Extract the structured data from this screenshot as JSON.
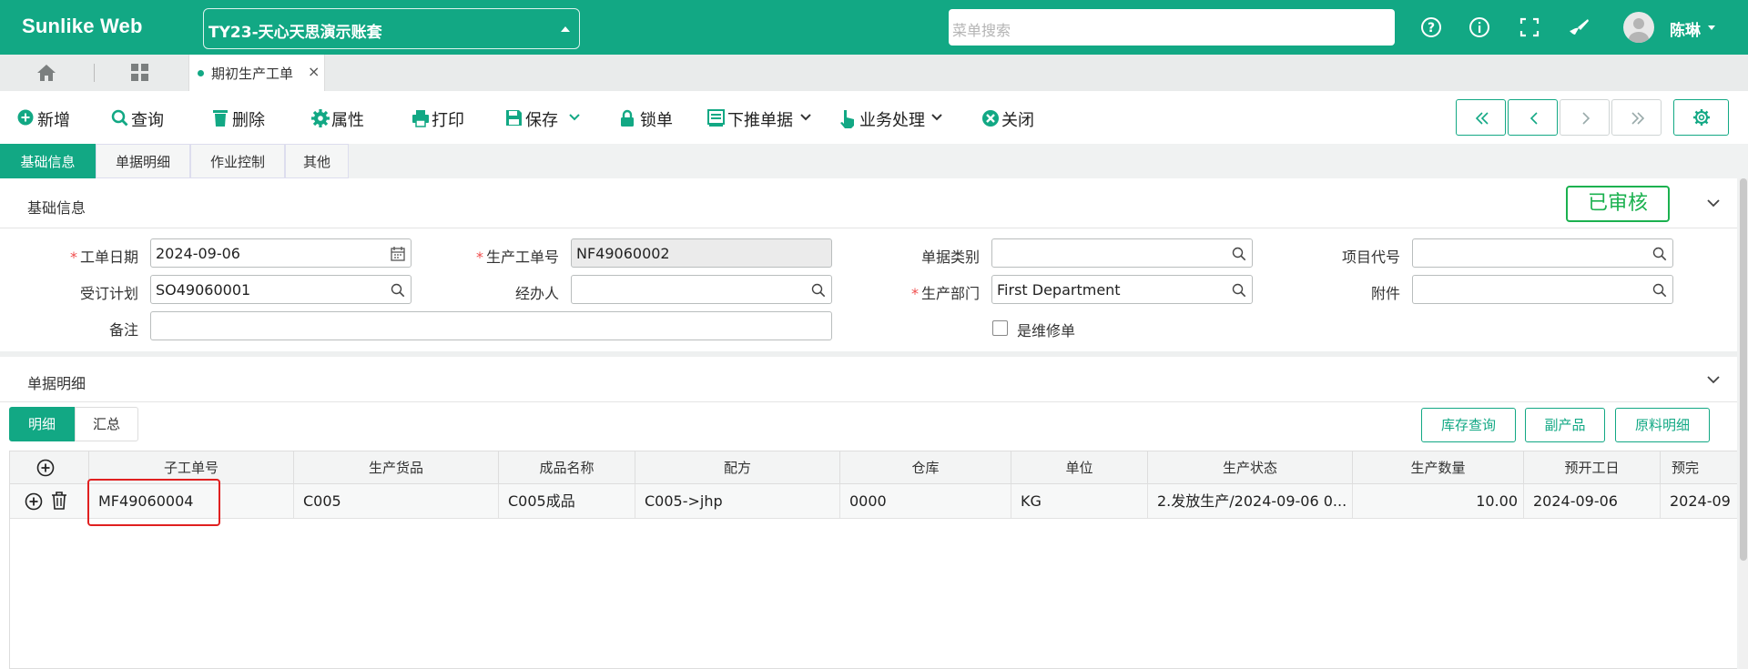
{
  "header": {
    "brand": "Sunlike Web",
    "account": "TY23-天心天思演示账套",
    "search_placeholder": "菜单搜索",
    "user_name": "陈琳",
    "icons": [
      "help-circle-icon",
      "info-circle-icon",
      "fullscreen-icon",
      "theme-brush-icon",
      "user-avatar-icon"
    ]
  },
  "tabs": {
    "open_tab_label": "期初生产工单",
    "close_symbol": "×"
  },
  "toolbar": {
    "add": "新增",
    "query": "查询",
    "delete": "删除",
    "properties": "属性",
    "print": "打印",
    "save": "保存",
    "lock": "锁单",
    "push_down": "下推单据",
    "business": "业务处理",
    "close": "关闭"
  },
  "subtabs": [
    "基础信息",
    "单据明细",
    "作业控制",
    "其他"
  ],
  "base_info": {
    "title": "基础信息",
    "status_stamp": "已审核",
    "fields": {
      "work_date_label": "工单日期",
      "work_date_value": "2024-09-06",
      "order_no_label": "生产工单号",
      "order_no_value": "NF49060002",
      "doc_type_label": "单据类别",
      "doc_type_value": "",
      "project_label": "项目代号",
      "project_value": "",
      "plan_label": "受订计划",
      "plan_value": "SO49060001",
      "handler_label": "经办人",
      "handler_value": "",
      "dept_label": "生产部门",
      "dept_value": "First Department",
      "attach_label": "附件",
      "attach_value": "",
      "remark_label": "备注",
      "remark_value": "",
      "repair_label": "是维修单"
    }
  },
  "detail": {
    "title": "单据明细",
    "toggle": [
      "明细",
      "汇总"
    ],
    "actions": [
      "库存查询",
      "副产品",
      "原料明细"
    ],
    "columns": [
      "子工单号",
      "生产货品",
      "成品名称",
      "配方",
      "仓库",
      "单位",
      "生产状态",
      "生产数量",
      "预开工日",
      "预完"
    ],
    "rows": [
      [
        "MF49060004",
        "C005",
        "C005成品",
        "C005->jhp",
        "0000",
        "KG",
        "2.发放生产/2024-09-06 0...",
        "10.00",
        "2024-09-06",
        "2024-09"
      ]
    ]
  }
}
